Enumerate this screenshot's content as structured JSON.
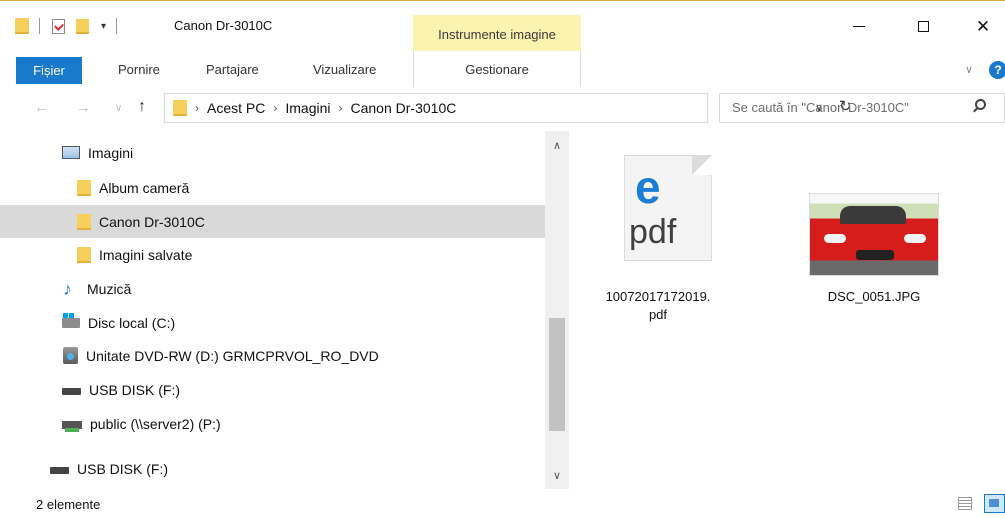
{
  "window": {
    "title": "Canon Dr-3010C",
    "context_group": "Instrumente imagine"
  },
  "ribbon": {
    "tabs": [
      "Fișier",
      "Pornire",
      "Partajare",
      "Vizualizare",
      "Gestionare"
    ]
  },
  "address": {
    "crumbs": [
      "Acest PC",
      "Imagini",
      "Canon Dr-3010C"
    ]
  },
  "search": {
    "placeholder": "Se caută în \"Canon Dr-3010C\""
  },
  "nav_tree": [
    {
      "label": "Imagini",
      "icon": "pictures-icon"
    },
    {
      "label": "Album cameră",
      "icon": "folder-icon"
    },
    {
      "label": "Canon Dr-3010C",
      "icon": "folder-icon",
      "selected": true
    },
    {
      "label": "Imagini salvate",
      "icon": "folder-icon"
    },
    {
      "label": "Muzică",
      "icon": "music-icon"
    },
    {
      "label": "Disc local (C:)",
      "icon": "local-disk-icon"
    },
    {
      "label": "Unitate DVD-RW (D:) GRMCPRVOL_RO_DVD",
      "icon": "dvd-drive-icon"
    },
    {
      "label": "USB DISK (F:)",
      "icon": "usb-drive-icon"
    },
    {
      "label": "public (\\\\server2) (P:)",
      "icon": "network-drive-icon"
    },
    {
      "label": "USB DISK (F:)",
      "icon": "usb-drive-icon"
    }
  ],
  "files": [
    {
      "name_line1": "10072017172019.",
      "name_line2": "pdf",
      "icon": "pdf-edge-icon",
      "icon_letter": "e",
      "icon_text": "pdf"
    },
    {
      "name_line1": "DSC_0051.JPG",
      "icon": "jpg-thumbnail"
    }
  ],
  "status": {
    "item_count": "2 elemente"
  },
  "colors": {
    "accent": "#1979ca",
    "context_tab": "#fbf3b0",
    "selection": "#d9d9d9",
    "folder": "#f7cf5b"
  }
}
